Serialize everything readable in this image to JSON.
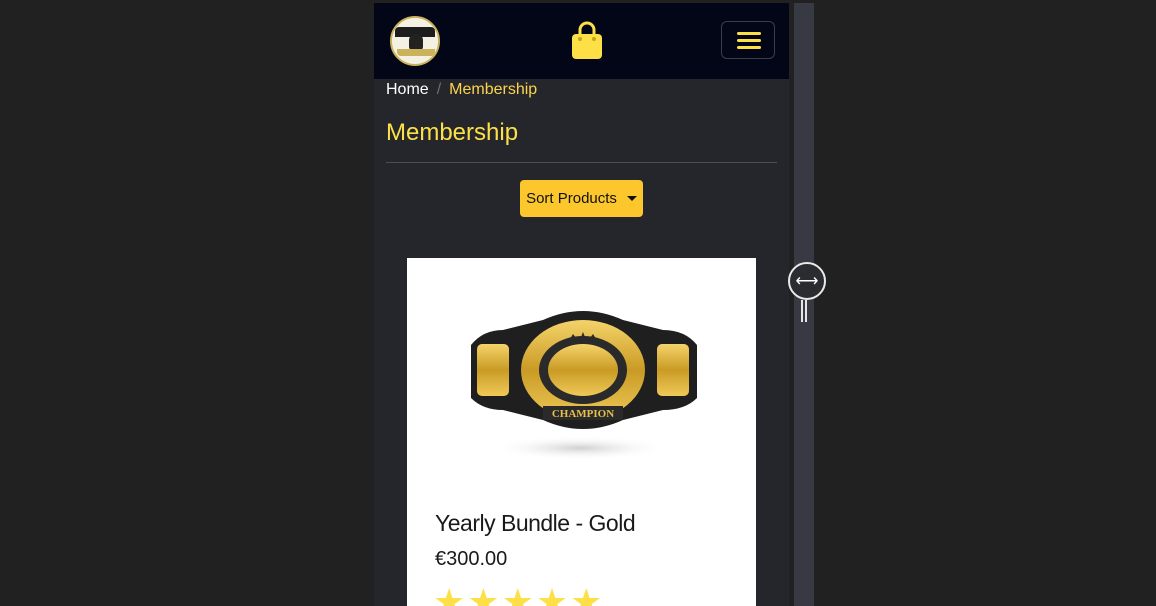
{
  "header": {
    "logo_name": "club-logo",
    "cart_icon": "shopping-bag-icon",
    "menu_icon": "hamburger-menu-icon"
  },
  "breadcrumb": {
    "home": "Home",
    "separator": "/",
    "current": "Membership"
  },
  "page": {
    "title": "Membership"
  },
  "sort": {
    "label": "Sort Products"
  },
  "product": {
    "name": "Yearly Bundle - Gold",
    "price": "€300.00",
    "rating": 5,
    "image": "champion-belt"
  },
  "colors": {
    "accent": "#fde047",
    "button": "#fcc72d",
    "navbar": "#020617",
    "background": "#24262b"
  }
}
